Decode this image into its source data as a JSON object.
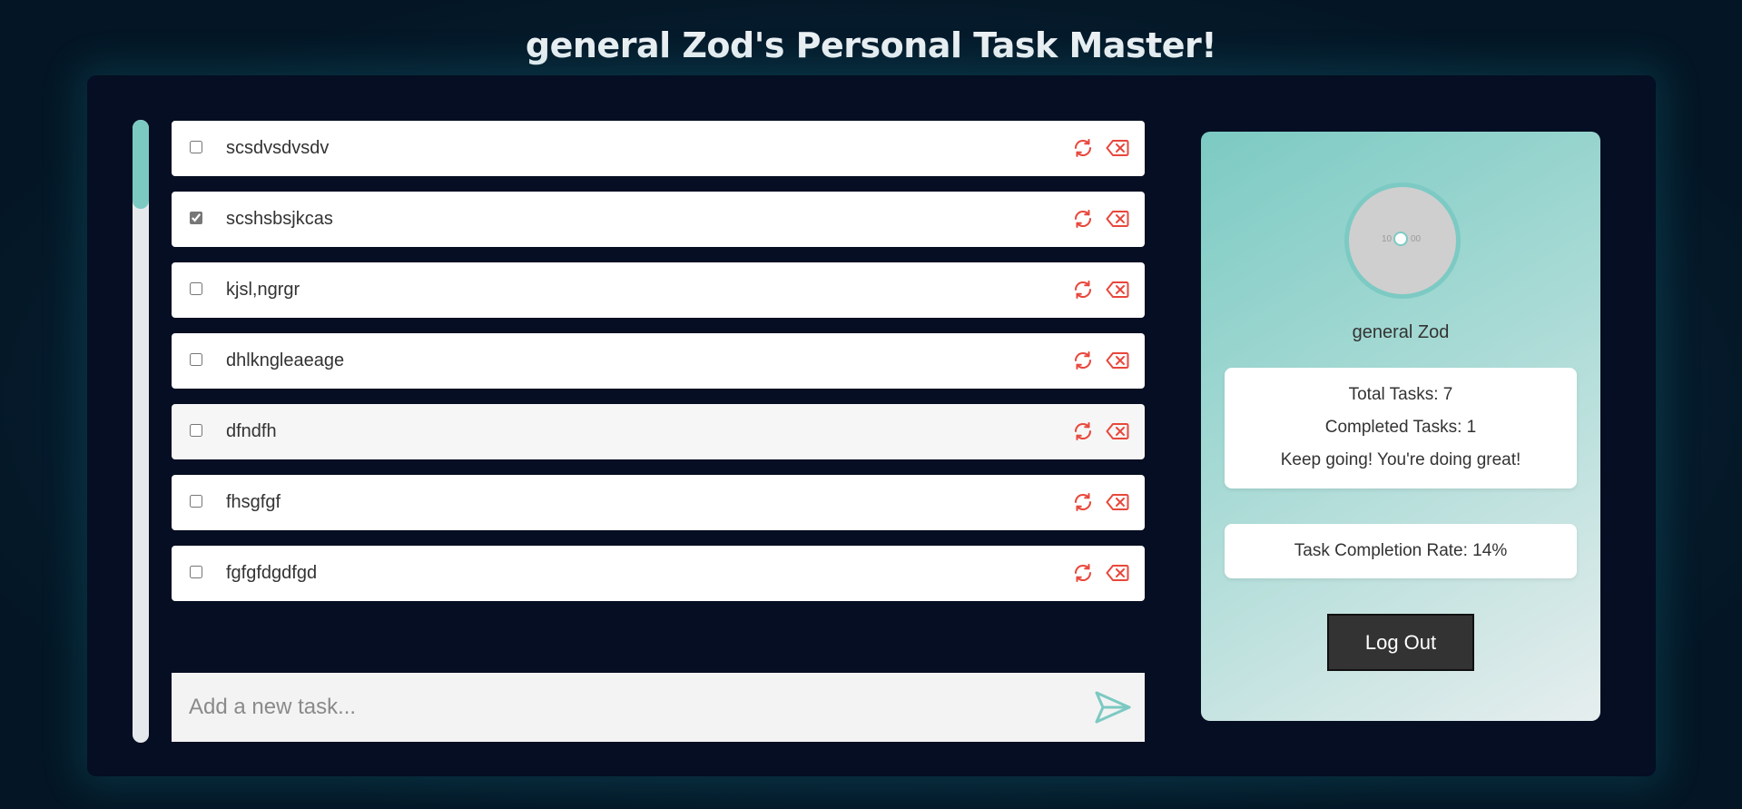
{
  "header": {
    "title": "general Zod's Personal Task Master!"
  },
  "tasks": [
    {
      "text": "scsdvsdvsdv",
      "completed": false
    },
    {
      "text": "scshsbsjkcas",
      "completed": true
    },
    {
      "text": "kjsl,ngrgr",
      "completed": false
    },
    {
      "text": "dhlkngleaeage",
      "completed": false
    },
    {
      "text": "dfndfh",
      "completed": false
    },
    {
      "text": "fhsgfgf",
      "completed": false
    },
    {
      "text": "fgfgfdgdfgd",
      "completed": false
    }
  ],
  "task_actions": {
    "update_icon": "refresh-icon",
    "delete_icon": "backspace-x-icon",
    "icon_color": "#e8473c"
  },
  "add_task": {
    "placeholder": "Add a new task...",
    "value": "",
    "send_icon": "send-arrow-icon",
    "icon_color": "#7cc9c2"
  },
  "profile": {
    "avatar_left_label": "10",
    "avatar_right_label": "00",
    "username": "general Zod",
    "stats": {
      "total_label": "Total Tasks: 7",
      "completed_label": "Completed Tasks: 1",
      "message": "Keep going! You're doing great!"
    },
    "completion_rate_label": "Task Completion Rate: 14%",
    "logout_label": "Log Out"
  },
  "colors": {
    "accent": "#7cc9c2",
    "background": "#050e22",
    "danger": "#e8473c"
  }
}
